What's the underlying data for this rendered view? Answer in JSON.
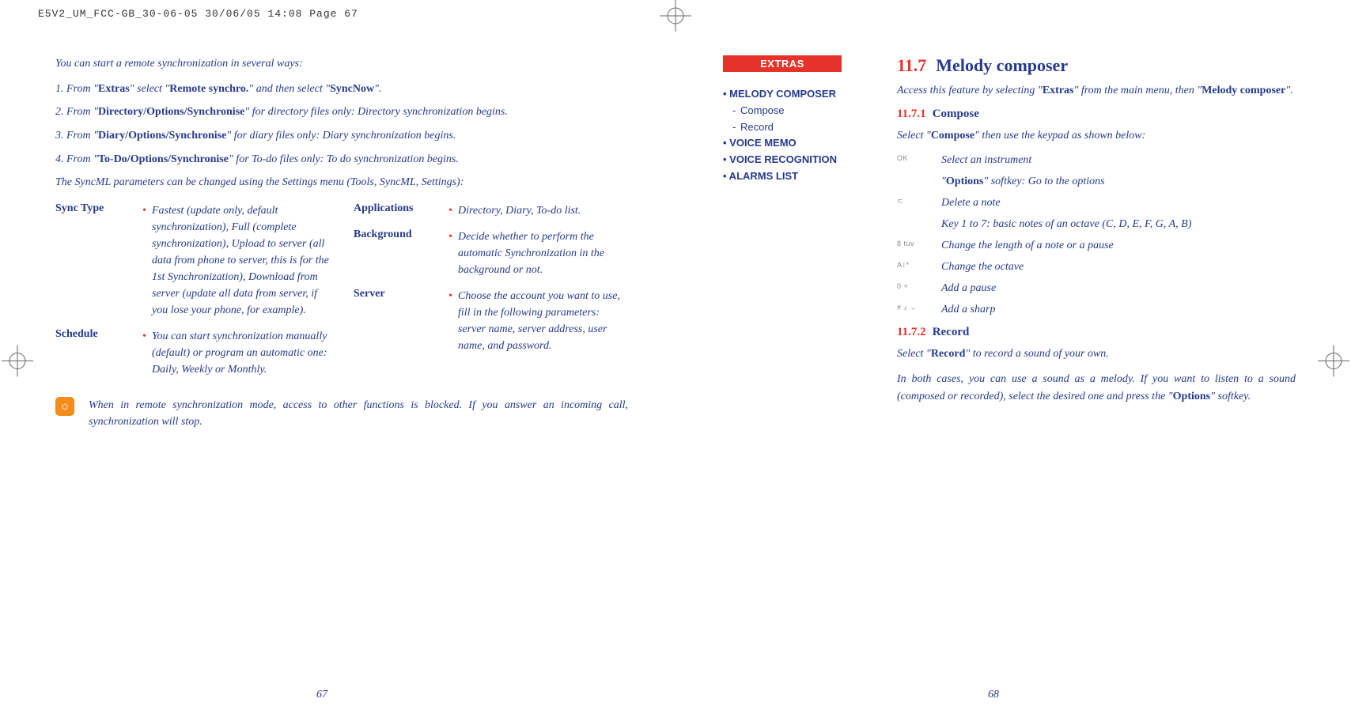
{
  "header": "E5V2_UM_FCC-GB_30-06-05  30/06/05  14:08  Page 67",
  "left": {
    "intro": "You can start a remote synchronization in several ways:",
    "items": [
      {
        "prefix": "1. From \"",
        "b1": "Extras",
        "mid1": "\" select \"",
        "b2": "Remote synchro.",
        "mid2": "\" and then select \"",
        "b3": "SyncNow",
        "suffix": "\"."
      },
      {
        "prefix": "2. From \"",
        "b1": "Directory/Options/Synchronise",
        "suffix": "\" for directory files only: Directory synchronization begins."
      },
      {
        "prefix": "3. From \"",
        "b1": "Diary/Options/Synchronise",
        "suffix": "\" for diary files only: Diary synchronization begins."
      },
      {
        "prefix": "4. From \"",
        "b1": "To-Do/Options/Synchronise",
        "suffix": "\" for To-do files only: To do synchronization begins."
      }
    ],
    "settingsLine": "The SyncML parameters can be changed using the Settings menu (Tools, SyncML, Settings):",
    "paramsLeft": [
      {
        "label": "Sync Type",
        "text": "Fastest (update only, default synchronization), Full (complete synchronization), Upload to server (all data from phone to server, this is for the 1st Synchronization), Download from server (update all data from server, if you lose your phone, for example)."
      },
      {
        "label": "Schedule",
        "text": "You can start synchronization manually (default) or program an automatic one: Daily, Weekly or Monthly."
      }
    ],
    "paramsRight": [
      {
        "label": "Applications",
        "text": "Directory, Diary, To-do list."
      },
      {
        "label": "Background",
        "text": "Decide whether to perform the automatic Synchronization in the background or not."
      },
      {
        "label": "Server",
        "text": "Choose the account you want to use, fill in the following parameters: server name, server address, user name, and password."
      }
    ],
    "note": "When in remote synchronization mode, access to other functions is blocked. If you answer an incoming call, synchronization will stop.",
    "pageNum": "67"
  },
  "right": {
    "chip": "EXTRAS",
    "toc": [
      {
        "text": "• MELODY COMPOSER",
        "bold": true
      },
      {
        "text": "Compose",
        "sub": true
      },
      {
        "text": "Record",
        "sub": true
      },
      {
        "text": "• VOICE MEMO",
        "bold": true
      },
      {
        "text": "• VOICE RECOGNITION",
        "bold": true
      },
      {
        "text": "• ALARMS LIST",
        "bold": true
      }
    ],
    "sec1Num": "11.7",
    "sec1Title": "Melody composer",
    "sec1Body_a": "Access this feature by selecting \"",
    "sec1Body_b1": "Extras",
    "sec1Body_c": "\" from the main menu, then \"",
    "sec1Body_b2": "Melody composer",
    "sec1Body_d": "\".",
    "sec11Num": "11.7.1",
    "sec11Title": "Compose",
    "sec11Body_a": "Select \"",
    "sec11Body_b": "Compose",
    "sec11Body_c": "\" then use the keypad as shown below:",
    "keys": [
      {
        "icon": "OK",
        "text": "Select an instrument"
      },
      {
        "icon": "",
        "text_a": "\"",
        "text_b": "Options",
        "text_c": "\" softkey: Go to the options"
      },
      {
        "icon": "⊂",
        "text": "Delete a note"
      },
      {
        "icon": "",
        "text": "Key 1 to 7: basic notes of an octave (C, D, E, F, G, A, B)"
      },
      {
        "icon": "8 tuv",
        "text": "Change the length of a note or a pause"
      },
      {
        "icon": "A↕*",
        "text": "Change the octave"
      },
      {
        "icon": "0 +",
        "text": "Add a pause"
      },
      {
        "icon": "# ♪ ←",
        "text": "Add a sharp"
      }
    ],
    "sec12Num": "11.7.2",
    "sec12Title": "Record",
    "sec12Body_a": "Select \"",
    "sec12Body_b": "Record",
    "sec12Body_c": "\" to record a sound of your own.",
    "closing_a": "In both cases, you can use a sound as a melody. If you want to listen to a sound (composed or recorded), select the desired one and press the \"",
    "closing_b": "Options",
    "closing_c": "\" softkey.",
    "pageNum": "68"
  }
}
